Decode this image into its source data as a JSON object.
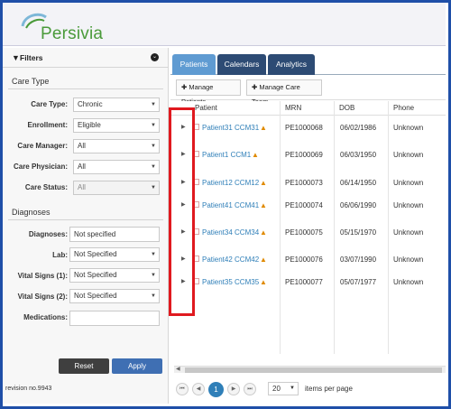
{
  "header": {
    "logo_text": "Persivia"
  },
  "sidebar": {
    "filters_title": "Filters",
    "care_type_section": "Care Type",
    "fields": [
      {
        "label": "Care Type:",
        "value": "Chronic"
      },
      {
        "label": "Enrollment:",
        "value": "Eligible"
      },
      {
        "label": "Care Manager:",
        "value": "All"
      },
      {
        "label": "Care Physician:",
        "value": "All"
      },
      {
        "label": "Care Status:",
        "value": "All"
      }
    ],
    "diagnoses_section": "Diagnoses",
    "diag_fields": [
      {
        "label": "Diagnoses:",
        "value": "Not specified"
      },
      {
        "label": "Lab:",
        "value": "Not Specified"
      },
      {
        "label": "Vital Signs (1):",
        "value": "Not Specified"
      },
      {
        "label": "Vital Signs (2):",
        "value": "Not Specified"
      },
      {
        "label": "Medications:",
        "value": ""
      }
    ],
    "reset_label": "Reset",
    "apply_label": "Apply",
    "revision": "revision no.9943"
  },
  "tabs": {
    "patients": "Patients",
    "calendars": "Calendars",
    "analytics": "Analytics"
  },
  "toolbar": {
    "manage_patients": "Manage Patients",
    "manage_care_team": "Manage Care Team"
  },
  "grid": {
    "headers": {
      "patient": "Patient",
      "mrn": "MRN",
      "dob": "DOB",
      "phone": "Phone"
    },
    "rows": [
      {
        "patient": "Patient31 CCM31",
        "mrn": "PE1000068",
        "dob": "06/02/1986",
        "phone": "Unknown"
      },
      {
        "patient": "Patient1 CCM1",
        "mrn": "PE1000069",
        "dob": "06/03/1950",
        "phone": "Unknown"
      },
      {
        "patient": "Patient12 CCM12",
        "mrn": "PE1000073",
        "dob": "06/14/1950",
        "phone": "Unknown"
      },
      {
        "patient": "Patient41 CCM41",
        "mrn": "PE1000074",
        "dob": "06/06/1990",
        "phone": "Unknown"
      },
      {
        "patient": "Patient34 CCM34",
        "mrn": "PE1000075",
        "dob": "05/15/1970",
        "phone": "Unknown"
      },
      {
        "patient": "Patient42 CCM42",
        "mrn": "PE1000076",
        "dob": "03/07/1990",
        "phone": "Unknown"
      },
      {
        "patient": "Patient35 CCM35",
        "mrn": "PE1000077",
        "dob": "05/07/1977",
        "phone": "Unknown"
      }
    ]
  },
  "pager": {
    "current_page": "1",
    "page_size": "20",
    "items_label": "items per page"
  },
  "colors": {
    "accent": "#2f7fb8",
    "tab_active": "#5f9bd2",
    "tab_inactive": "#2d4b74",
    "highlight": "#e0191f",
    "brand": "#4a9a3a"
  }
}
